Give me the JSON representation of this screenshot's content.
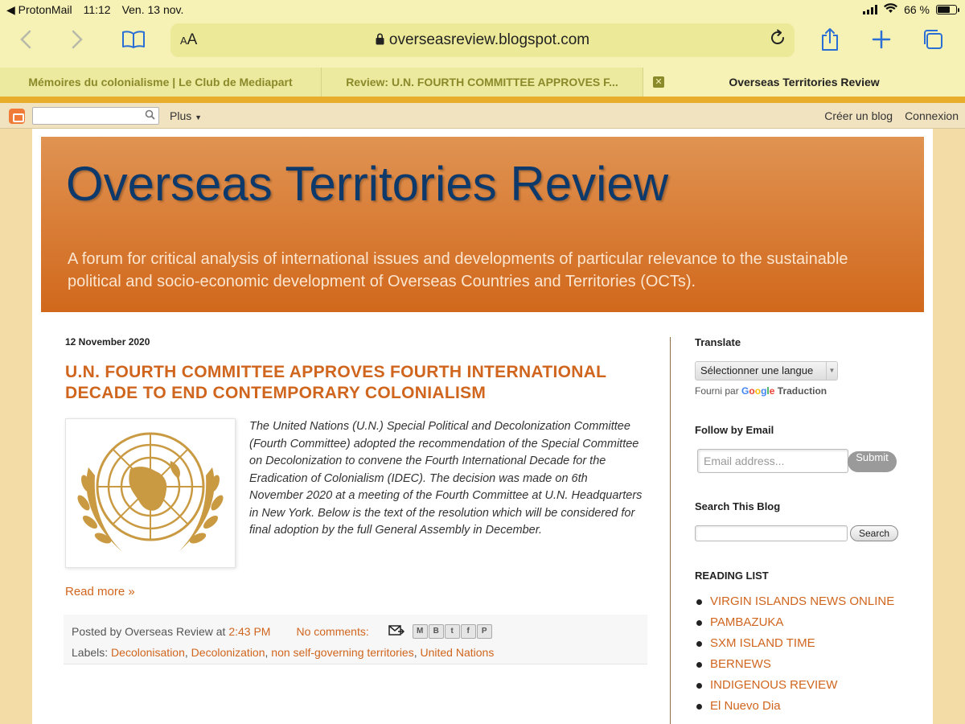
{
  "status_bar": {
    "back_app": "◀ ProtonMail",
    "time": "11:12",
    "date": "Ven. 13 nov.",
    "battery": "66 %",
    "battery_level": 0.66
  },
  "browser": {
    "text_size_label": "AA",
    "url": "overseasreview.blogspot.com",
    "tabs": [
      {
        "title": "Mémoires du colonialisme | Le Club de Mediapart"
      },
      {
        "title": "Review: U.N. FOURTH COMMITTEE APPROVES F..."
      },
      {
        "title": "Overseas Territories Review"
      }
    ]
  },
  "navbar": {
    "more_label": "Plus",
    "create_blog": "Créer un blog",
    "sign_in": "Connexion"
  },
  "blog": {
    "title": "Overseas Territories Review",
    "description": "A forum for critical analysis of international issues and developments of particular relevance to the sustainable political and socio-economic development of Overseas Countries and Territories (OCTs)."
  },
  "post": {
    "date": "12 November 2020",
    "title": "U.N. FOURTH COMMITTEE APPROVES FOURTH INTERNATIONAL DECADE TO END CONTEMPORARY COLONIALISM",
    "body": "The United Nations (U.N.) Special Political and Decolonization Committee (Fourth Committee) adopted the recommendation of the Special Committee on Decolonization to convene the Fourth International Decade for the Eradication of Colonialism (IDEC). The decision was made on 6th November 2020 at a meeting of the Fourth Committee at U.N. Headquarters in New York. Below is the text of the resolution which will be considered for final adoption by the full General Assembly in December.",
    "read_more": "Read more »",
    "posted_by_prefix": "Posted by",
    "author": "Overseas Review",
    "at_label": "at",
    "time": "2:43 PM",
    "comments": "No comments:",
    "labels_prefix": "Labels:",
    "labels": [
      "Decolonisation",
      "Decolonization",
      "non self-governing territories",
      "United Nations"
    ]
  },
  "sidebar": {
    "translate_title": "Translate",
    "select_language": "Sélectionner une langue",
    "powered_by": "Fourni par",
    "translate_brand": "Traduction",
    "follow_title": "Follow by Email",
    "email_placeholder": "Email address...",
    "submit_label": "Submit",
    "search_title": "Search This Blog",
    "search_button": "Search",
    "reading_title": "READING LIST",
    "reading_list": [
      "VIRGIN ISLANDS NEWS ONLINE",
      "PAMBAZUKA",
      "SXM ISLAND TIME",
      "BERNEWS",
      "INDIGENOUS REVIEW",
      "El Nuevo Dia"
    ]
  },
  "colors": {
    "accent": "#d0651e",
    "title_blue": "#0e3a6b",
    "safari_tint": "#f6f1b4",
    "ios_blue": "#2a6fd6"
  }
}
